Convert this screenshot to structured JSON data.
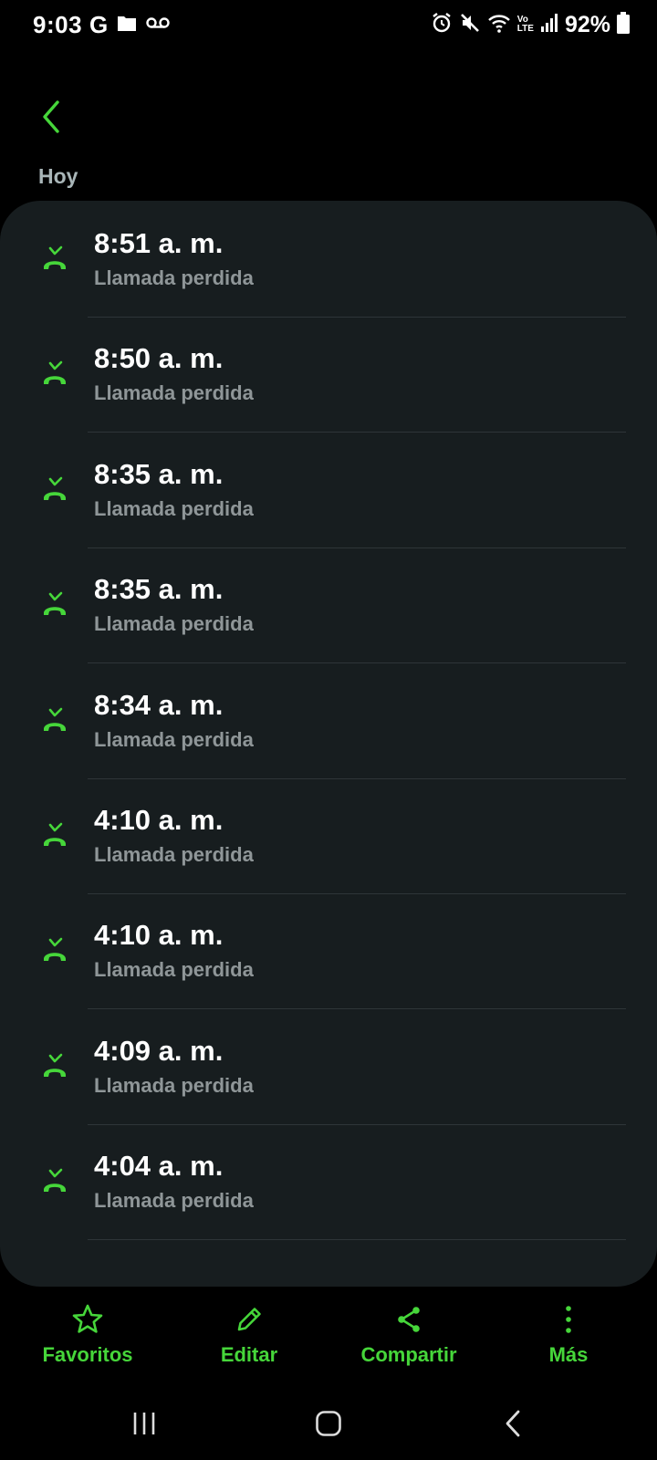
{
  "status_bar": {
    "time": "9:03",
    "g_label": "G",
    "left_icons": [
      "google-icon",
      "folder-icon",
      "voicemail-icon"
    ],
    "right_icons": [
      "alarm-icon",
      "mute-icon",
      "wifi-icon",
      "volte-icon",
      "signal-icon",
      "battery-icon"
    ],
    "volte_line1": "Vo",
    "volte_line2": "LTE",
    "battery": "92%"
  },
  "header": {
    "back_icon": "chevron-left-icon",
    "section_title": "Hoy"
  },
  "call_log": {
    "items": [
      {
        "time": "8:51 a. m.",
        "status": "Llamada perdida"
      },
      {
        "time": "8:50 a. m.",
        "status": "Llamada perdida"
      },
      {
        "time": "8:35 a. m.",
        "status": "Llamada perdida"
      },
      {
        "time": "8:35 a. m.",
        "status": "Llamada perdida"
      },
      {
        "time": "8:34 a. m.",
        "status": "Llamada perdida"
      },
      {
        "time": "4:10 a. m.",
        "status": "Llamada perdida"
      },
      {
        "time": "4:10 a. m.",
        "status": "Llamada perdida"
      },
      {
        "time": "4:09 a. m.",
        "status": "Llamada perdida"
      },
      {
        "time": "4:04 a. m.",
        "status": "Llamada perdida"
      }
    ],
    "item_icon": "missed-call-icon"
  },
  "bottom_actions": {
    "favorites": {
      "label": "Favoritos",
      "icon": "star-icon"
    },
    "edit": {
      "label": "Editar",
      "icon": "pencil-icon"
    },
    "share": {
      "label": "Compartir",
      "icon": "share-icon"
    },
    "more": {
      "label": "Más",
      "icon": "more-vertical-icon"
    }
  },
  "nav_bar": {
    "icons": [
      "recents-icon",
      "home-icon",
      "back-icon"
    ]
  },
  "colors": {
    "background": "#000000",
    "card": "#171d1f",
    "accent": "#46d63a",
    "primary_text": "#ffffff",
    "secondary_text": "#8f9698",
    "section_title": "#a9b6b8",
    "divider": "#2e3538"
  }
}
